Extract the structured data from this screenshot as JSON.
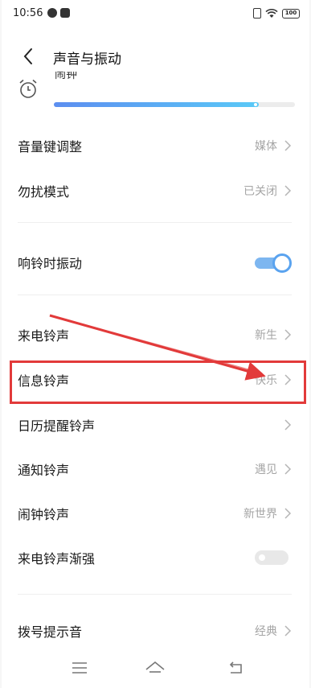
{
  "status_bar": {
    "time": "10:56",
    "battery": "100",
    "icons": [
      "app-notification-icon",
      "app-notification-icon-2",
      "sim-icon",
      "wifi-icon",
      "battery-icon"
    ]
  },
  "header": {
    "title": "声音与振动",
    "back_icon": "chevron-left-icon"
  },
  "alarm": {
    "label": "闹钟",
    "icon": "alarm-clock-icon",
    "volume_level": 0.85,
    "accent_gradient": [
      "#5c8ef0",
      "#5ac9f7"
    ]
  },
  "rows": {
    "volume_key": {
      "label": "音量键调整",
      "value": "媒体"
    },
    "dnd": {
      "label": "勿扰模式",
      "value": "已关闭"
    },
    "vibrate_on_ring": {
      "label": "响铃时振动",
      "toggle": true
    },
    "ringtone": {
      "label": "来电铃声",
      "value": "新生"
    },
    "message_tone": {
      "label": "信息铃声",
      "value": "快乐"
    },
    "calendar_tone": {
      "label": "日历提醒铃声",
      "value": ""
    },
    "notification_tone": {
      "label": "通知铃声",
      "value": "遇见"
    },
    "alarm_tone": {
      "label": "闹钟铃声",
      "value": "新世界"
    },
    "ring_crescendo": {
      "label": "来电铃声渐强",
      "toggle": false
    },
    "dial_tone": {
      "label": "拨号提示音",
      "value": "经典"
    }
  },
  "annotation": {
    "box_color": "#e23a3a",
    "arrow_color": "#e23a3a"
  },
  "nav_bar": {
    "icons": [
      "menu-icon",
      "home-icon",
      "back-icon"
    ]
  }
}
